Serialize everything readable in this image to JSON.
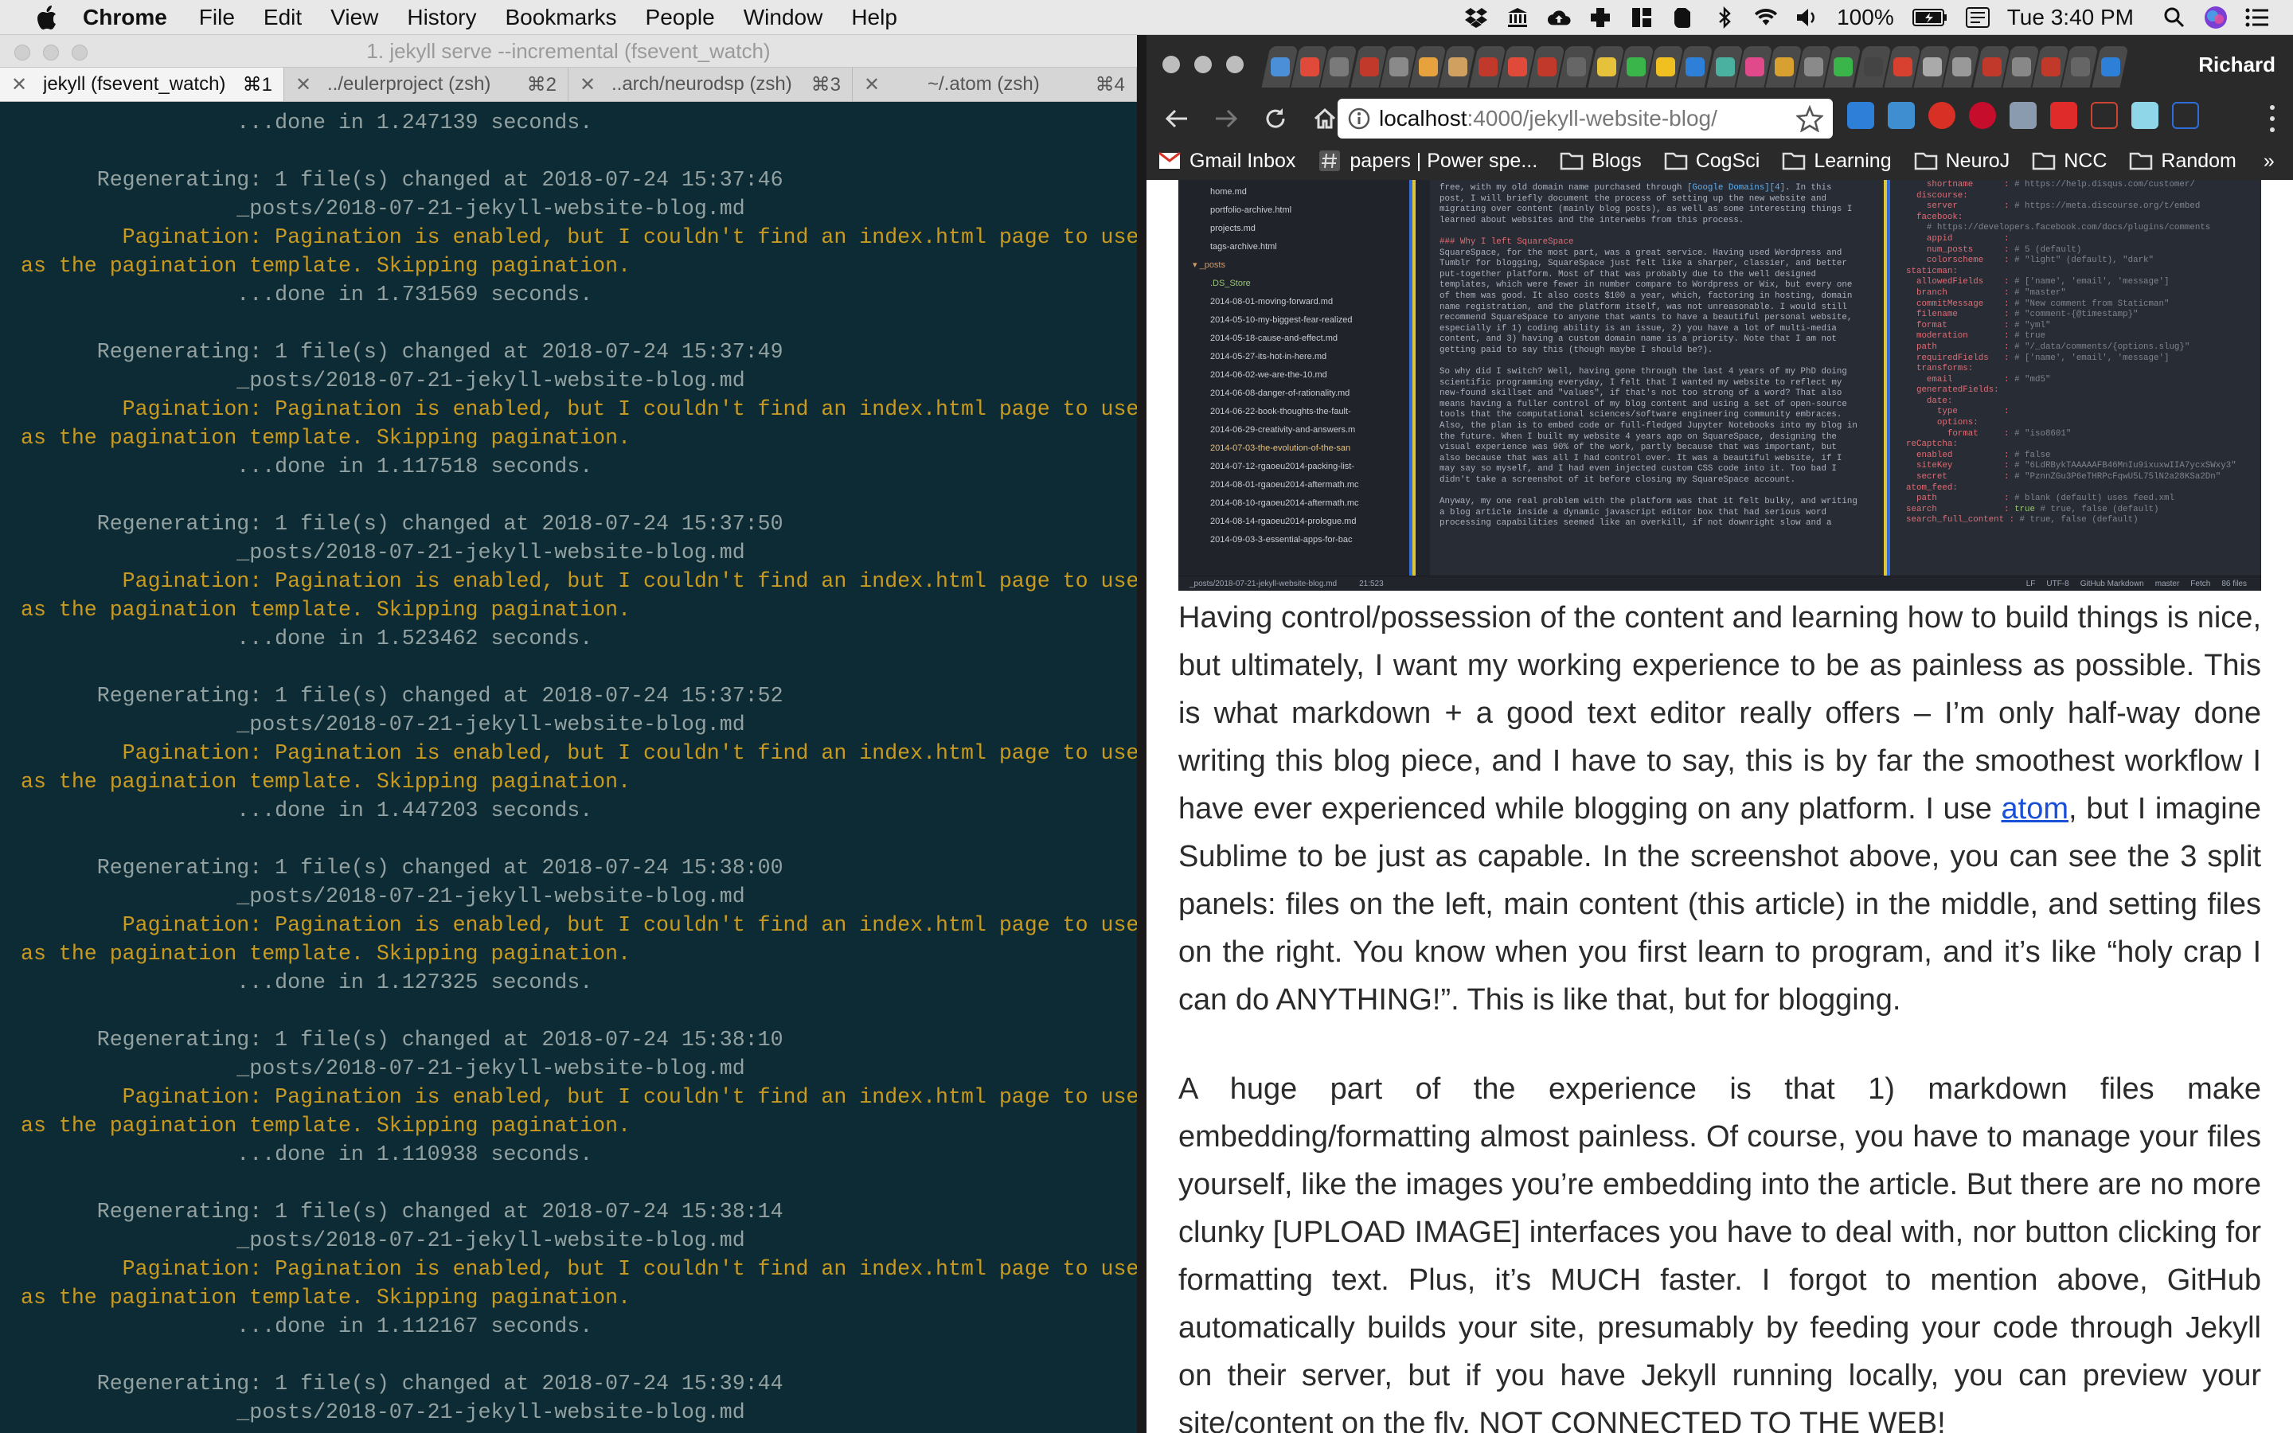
{
  "menubar": {
    "app": "Chrome",
    "items": [
      "File",
      "Edit",
      "View",
      "History",
      "Bookmarks",
      "People",
      "Window",
      "Help"
    ],
    "battery": "100%",
    "clock": "Tue 3:40 PM"
  },
  "terminal": {
    "title": "1. jekyll serve --incremental (fsevent_watch)",
    "tabs": [
      {
        "name": "jekyll (fsevent_watch)",
        "key": "⌘1"
      },
      {
        "name": "../eulerproject (zsh)",
        "key": "⌘2"
      },
      {
        "name": "..arch/neurodsp (zsh)",
        "key": "⌘3"
      },
      {
        "name": "~/.atom (zsh)",
        "key": "⌘4"
      }
    ],
    "first_line": "                 ...done in 1.247139 seconds.",
    "blocks": [
      {
        "time": "2018-07-24 15:37:46",
        "done": "1.731569"
      },
      {
        "time": "2018-07-24 15:37:49",
        "done": "1.117518"
      },
      {
        "time": "2018-07-24 15:37:50",
        "done": "1.523462"
      },
      {
        "time": "2018-07-24 15:37:52",
        "done": "1.447203"
      },
      {
        "time": "2018-07-24 15:38:00",
        "done": "1.127325"
      },
      {
        "time": "2018-07-24 15:38:10",
        "done": "1.110938"
      },
      {
        "time": "2018-07-24 15:38:14",
        "done": "1.112167"
      },
      {
        "time": "2018-07-24 15:39:44",
        "done": ""
      }
    ],
    "regen_prefix": "Regenerating: 1 file(s) changed at ",
    "file": "_posts/2018-07-21-jekyll-website-blog.md",
    "warn_1": "Pagination: Pagination is enabled, but I couldn't find an index.html page to use",
    "warn_2": "as the pagination template. Skipping pagination.",
    "done_prefix": "...done in ",
    "done_suffix": " seconds."
  },
  "chrome": {
    "profile": "Richard",
    "url_host": "localhost",
    "url_path": ":4000/jekyll-website-blog/",
    "bookmarks": [
      {
        "label": "Gmail Inbox",
        "icon": "gmail-icon"
      },
      {
        "label": "papers | Power spe...",
        "icon": "hashtag-icon"
      },
      {
        "label": "Blogs",
        "icon": "folder-icon"
      },
      {
        "label": "CogSci",
        "icon": "folder-icon"
      },
      {
        "label": "Learning",
        "icon": "folder-icon"
      },
      {
        "label": "NeuroJ",
        "icon": "folder-icon"
      },
      {
        "label": "NCC",
        "icon": "folder-icon"
      },
      {
        "label": "Random",
        "icon": "folder-icon"
      }
    ],
    "bookmarks_more": "»"
  },
  "atom": {
    "tree": [
      "home.md",
      "portfolio-archive.html",
      "projects.md",
      "tags-archive.html",
      "_posts",
      ".DS_Store",
      "2014-08-01-moving-forward.md",
      "2014-05-10-my-biggest-fear-realized",
      "2014-05-18-cause-and-effect.md",
      "2014-05-27-its-hot-in-here.md",
      "2014-06-02-we-are-the-10.md",
      "2014-06-08-danger-of-rationality.md",
      "2014-06-22-book-thoughts-the-fault-",
      "2014-06-29-creativity-and-answers.m",
      "2014-07-03-the-evolution-of-the-san",
      "2014-07-12-rgaoeu2014-packing-list-",
      "2014-08-01-rgaoeu2014-aftermath.mc",
      "2014-08-10-rgaoeu2014-aftermath.mc",
      "2014-08-14-rgaoeu2014-prologue.md",
      "2014-09-03-3-essential-apps-for-bac"
    ],
    "status_left": "_posts/2018-07-21-jekyll-website-blog.md",
    "status_pos": "21:523",
    "status_right": [
      "LF",
      "UTF-8",
      "GitHub Markdown",
      "master",
      "Fetch",
      "86 files"
    ]
  },
  "article": {
    "p1_before_link": "Having control/possession of the content and learning how to build things is nice, but ultimately, I want my working experience to be as painless as possible. This is what markdown + a good text editor really offers – I’m only half-way done writing this blog piece, and I have to say, this is by far the smoothest workflow I have ever experienced while blogging on any platform. I use ",
    "p1_link": "atom",
    "p1_after_link": ", but I imagine Sublime to be just as capable. In the screenshot above, you can see the 3 split panels: files on the left, main content (this article) in the middle, and setting files on the right. You know when you first learn to program, and it’s like “holy crap I can do ANYTHING!”. This is like that, but for blogging.",
    "p2": "A huge part of the experience is that 1) markdown files make embedding/formatting almost painless. Of course, you have to manage your files yourself, like the images you’re embedding into the article. But there are no more clunky [UPLOAD IMAGE] interfaces you have to deal with, nor button clicking for formatting text. Plus, it’s MUCH faster. I forgot to mention above, GitHub automatically builds your site, presumably by feeding your code through Jekyll on their server, but if you have Jekyll running locally, you can preview your site/content on the fly, NOT CONNECTED TO THE WEB!"
  }
}
